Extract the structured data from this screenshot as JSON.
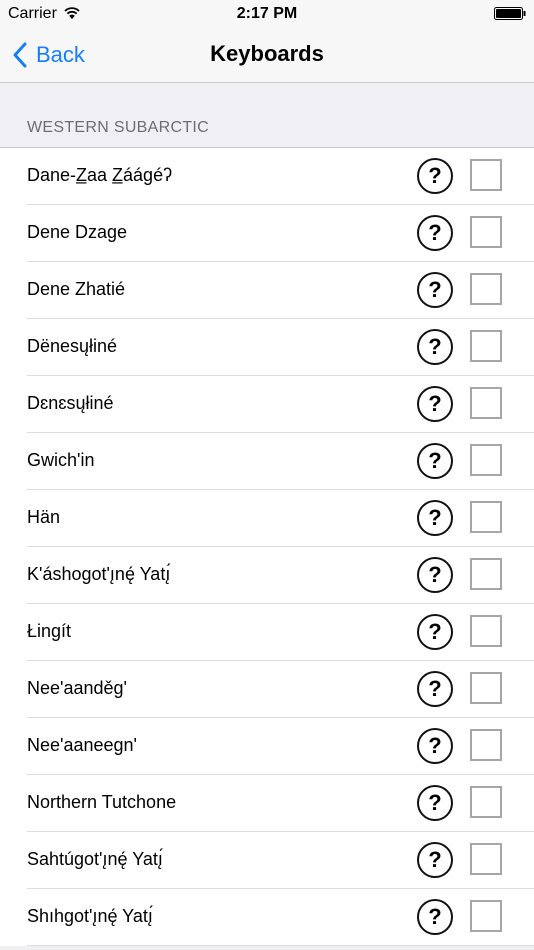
{
  "status_bar": {
    "carrier": "Carrier",
    "time": "2:17 PM",
    "wifi_icon": "wifi-icon",
    "battery_icon": "battery-icon"
  },
  "nav": {
    "back_label": "Back",
    "title": "Keyboards",
    "accent_color": "#147efb"
  },
  "section": {
    "header": "WESTERN SUBARCTIC"
  },
  "keyboards": [
    {
      "name": "Dane-Z̲aa Z̲áágéʔ",
      "help_label": "?",
      "checked": false
    },
    {
      "name": "Dene Dzage",
      "help_label": "?",
      "checked": false
    },
    {
      "name": "Dene Zhatié",
      "help_label": "?",
      "checked": false
    },
    {
      "name": "Dënesųłiné",
      "help_label": "?",
      "checked": false
    },
    {
      "name": "Dɛnɛsųłiné",
      "help_label": "?",
      "checked": false
    },
    {
      "name": "Gwich'in",
      "help_label": "?",
      "checked": false
    },
    {
      "name": "Hän",
      "help_label": "?",
      "checked": false
    },
    {
      "name": "K'áshogot'ı̨nę́ Yatı̨́",
      "help_label": "?",
      "checked": false
    },
    {
      "name": "Łingít",
      "help_label": "?",
      "checked": false
    },
    {
      "name": "Nee'aanděg'",
      "help_label": "?",
      "checked": false
    },
    {
      "name": "Nee'aaneegn'",
      "help_label": "?",
      "checked": false
    },
    {
      "name": "Northern Tutchone",
      "help_label": "?",
      "checked": false
    },
    {
      "name": "Sahtúgot'ı̨nę́ Yatı̨́",
      "help_label": "?",
      "checked": false
    },
    {
      "name": "Shıhgot'ı̨nę́ Yatı̨́",
      "help_label": "?",
      "checked": false
    }
  ]
}
